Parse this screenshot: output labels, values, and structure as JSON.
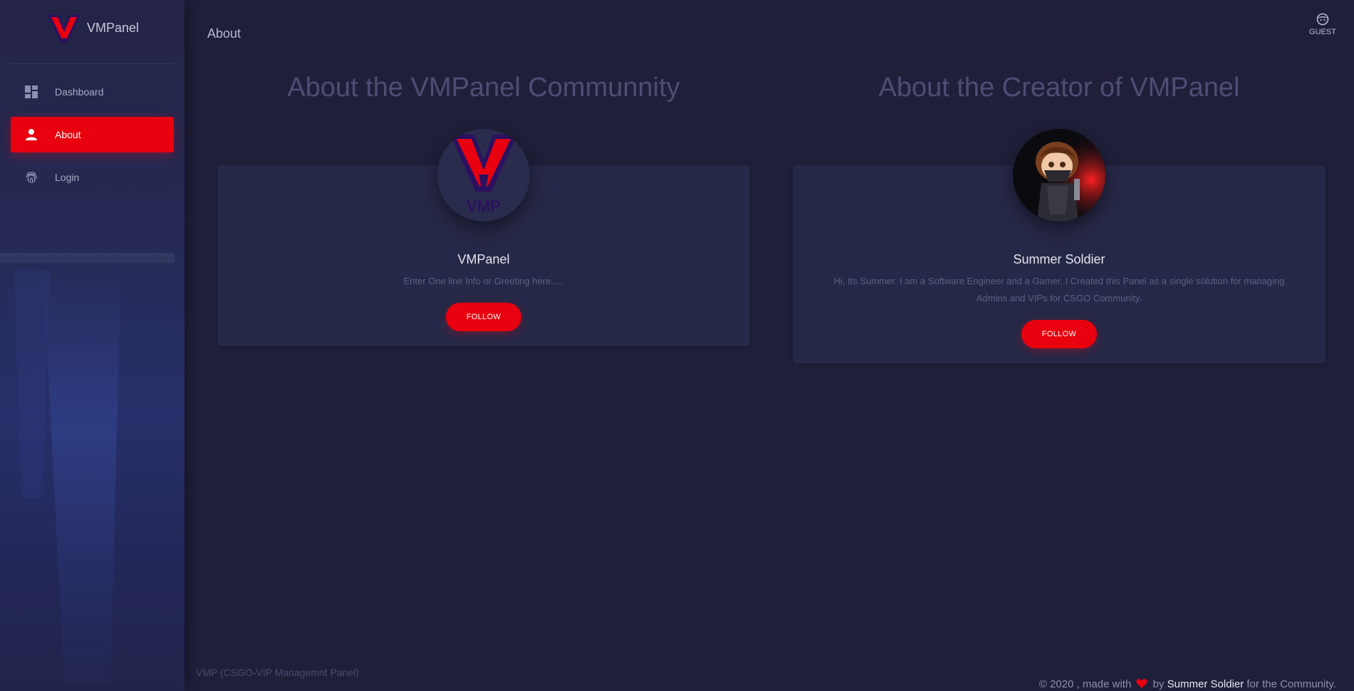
{
  "sidebar": {
    "brand": "VMPanel",
    "items": [
      {
        "label": "Dashboard",
        "icon": "dashboard-icon"
      },
      {
        "label": "About",
        "icon": "person-icon"
      },
      {
        "label": "Login",
        "icon": "fingerprint-icon"
      }
    ]
  },
  "header": {
    "title": "About",
    "user_label": "GUEST",
    "user_icon": "face-icon"
  },
  "sections": {
    "community": {
      "title": "About the VMPanel Communnity",
      "card_name": "VMPanel",
      "card_desc": "Enter One line Info or Greeting here.....",
      "button": "FOLLOW",
      "logo_text": "VMP"
    },
    "creator": {
      "title": "About the Creator of VMPanel",
      "card_name": "Summer Soldier",
      "card_desc": "Hi, Its Summer. I am a Software Engineer and a Gamer. I Created this Panel as a single solution for managing Admins and VIPs for CSGO Community.",
      "button": "FOLLOW"
    }
  },
  "footer": {
    "left": "VMP (CSGO-VIP Managemnt Panel)",
    "copyright": "© 2020 , made with",
    "by": "by",
    "author": "Summer Soldier",
    "suffix": "for the Community."
  },
  "colors": {
    "accent": "#e8000f",
    "background": "#1f1f3a",
    "card": "#262847"
  }
}
